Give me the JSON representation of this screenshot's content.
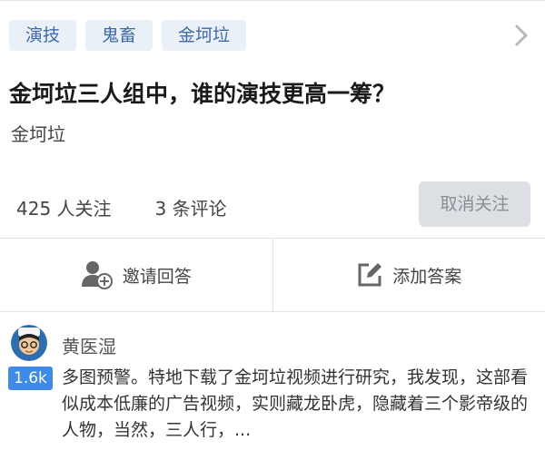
{
  "tags": [
    "演技",
    "鬼畜",
    "金坷垃"
  ],
  "question": {
    "title": "金坷垃三人组中，谁的演技更高一筹？",
    "topic": "金坷垃"
  },
  "stats": {
    "followers": "425 人关注",
    "comments": "3 条评论",
    "unfollow_label": "取消关注"
  },
  "actions": {
    "invite_label": "邀请回答",
    "add_answer_label": "添加答案"
  },
  "answer": {
    "author": "黄医湿",
    "votes": "1.6k",
    "excerpt": "多图预警。特地下载了金坷垃视频进行研究，我发现，这部看似成本低廉的广告视频，实则藏龙卧虎，隐藏着三个影帝级的人物，当然，三人行，..."
  },
  "icons": {
    "chevron": "chevron-right-icon",
    "invite": "add-user-icon",
    "edit": "edit-icon"
  },
  "colors": {
    "tag_bg": "#eaf0f8",
    "tag_text": "#3e6aa6",
    "vote_badge": "#3d8be6",
    "unfollow_bg": "#dcdfe3"
  }
}
